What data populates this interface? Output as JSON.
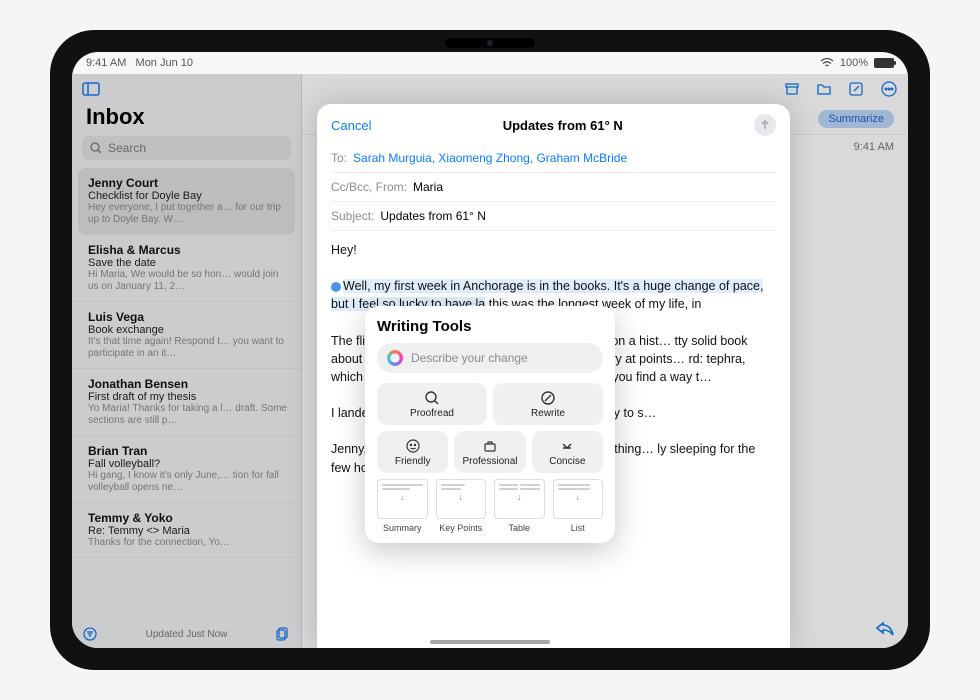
{
  "statusbar": {
    "time": "9:41 AM",
    "date": "Mon Jun 10",
    "batteryPct": "100%"
  },
  "sidebar": {
    "title": "Inbox",
    "search_placeholder": "Search",
    "footer": "Updated Just Now",
    "messages": [
      {
        "sender": "Jenny Court",
        "subject": "Checklist for Doyle Bay",
        "preview": "Hey everyone, I put together a… for our trip up to Doyle Bay. W…"
      },
      {
        "sender": "Elisha & Marcus",
        "subject": "Save the date",
        "preview": "Hi Maria, We would be so hon… would join us on January 11, 2…"
      },
      {
        "sender": "Luis Vega",
        "subject": "Book exchange",
        "preview": "It's that time again! Respond t… you want to participate in an it…"
      },
      {
        "sender": "Jonathan Bensen",
        "subject": "First draft of my thesis",
        "preview": "Yo Maria! Thanks for taking a l… draft. Some sections are still p…"
      },
      {
        "sender": "Brian Tran",
        "subject": "Fall volleyball?",
        "preview": "Hi gang, I know it's only June,… tion for fall volleyball opens ne…"
      },
      {
        "sender": "Temmy & Yoko",
        "subject": "Re: Temmy <> Maria",
        "preview": "Thanks for the connection, Yo…"
      }
    ]
  },
  "content": {
    "summarize": "Summarize",
    "time": "9:41 AM"
  },
  "compose": {
    "cancel": "Cancel",
    "title": "Updates from 61° N",
    "to_label": "To:",
    "recipients": "Sarah Murguia, Xiaomeng Zhong, Graham McBride",
    "cc_label": "Cc/Bcc, From:",
    "from_name": "Maria",
    "subject_label": "Subject:",
    "subject_value": "Updates from 61° N",
    "body": {
      "greeting": "Hey!",
      "p1a": "Well, my first week in Anchorage is in the books. It's a huge change of pace, but I feel so lucky to have la",
      "p1b": " this was the longest week of my life, in",
      "p2": "The flight up from… of the flight reading. I've been on a hist… tty solid book about the eruption of Ve… nd Pompeii. It's a little dry at points… rd: tephra, which is what we call most… rupts. Let me know if you find a way t…",
      "p3": "I landed in Anchor… ould still be out, it was so trippy to s…",
      "p4": "Jenny, an assistar… e airport. She told me the first thing… ly sleeping for the few hours it actua…"
    }
  },
  "writing_tools": {
    "title": "Writing Tools",
    "placeholder": "Describe your change",
    "proofread": "Proofread",
    "rewrite": "Rewrite",
    "friendly": "Friendly",
    "professional": "Professional",
    "concise": "Concise",
    "summary": "Summary",
    "keypoints": "Key Points",
    "table": "Table",
    "list": "List"
  }
}
